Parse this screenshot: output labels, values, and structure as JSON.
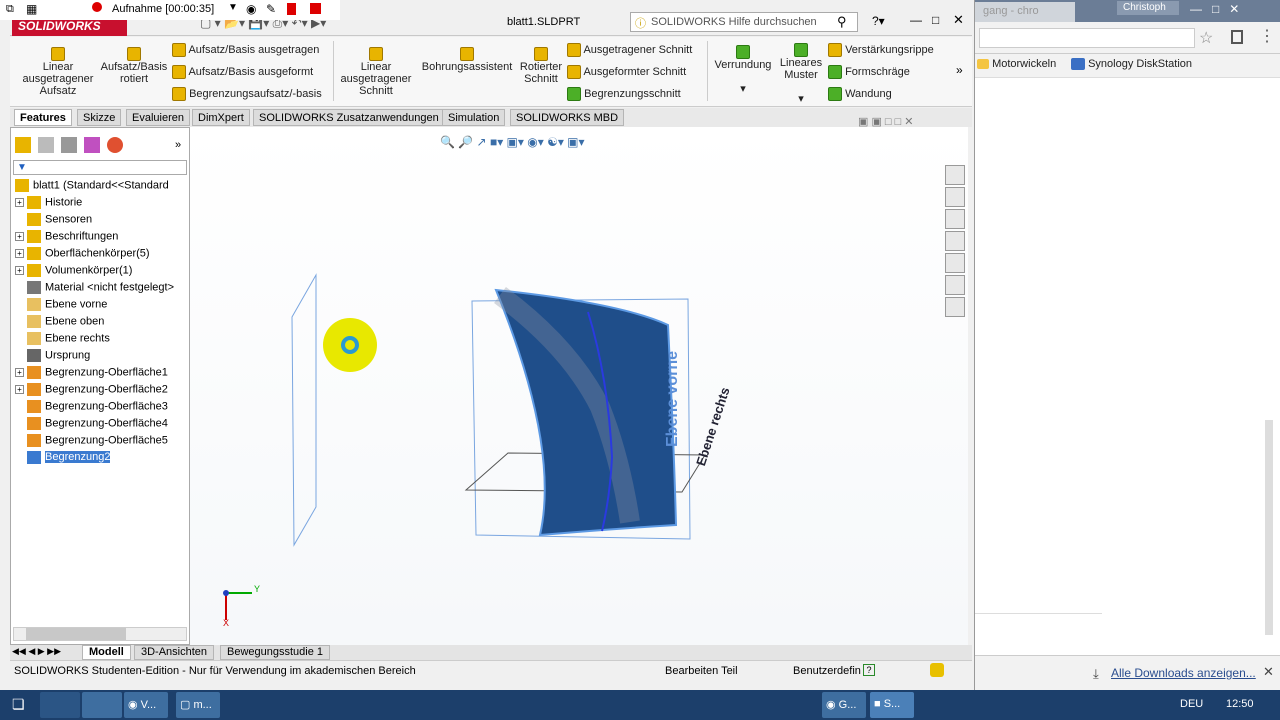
{
  "browser": {
    "tab_title": "gang - chro",
    "user_badge": "Christoph",
    "bookmarks": [
      "Motorwickeln",
      "Synology DiskStation"
    ],
    "downloads_link": "Alle Downloads anzeigen..."
  },
  "recording": {
    "label": "Aufnahme [00:00:35]"
  },
  "app": {
    "logo": "SOLIDWORKS",
    "doc_title": "blatt1.SLDPRT",
    "search_placeholder": "SOLIDWORKS Hilfe durchsuchen"
  },
  "ribbon": {
    "big": [
      {
        "label": "Linear ausgetragener Aufsatz"
      },
      {
        "label": "Aufsatz/Basis rotiert"
      },
      {
        "label": "Linear ausgetragener Schnitt"
      },
      {
        "label": "Bohrungsassistent"
      },
      {
        "label": "Rotierter Schnitt"
      },
      {
        "label": "Verrundung"
      },
      {
        "label": "Lineares Muster"
      }
    ],
    "small_col1": [
      "Aufsatz/Basis ausgetragen",
      "Aufsatz/Basis ausgeformt",
      "Begrenzungsaufsatz/-basis"
    ],
    "small_col2": [
      "Ausgetragener Schnitt",
      "Ausgeformter Schnitt",
      "Begrenzungsschnitt"
    ],
    "small_col3": [
      "Verstärkungsrippe",
      "Formschräge",
      "Wandung"
    ]
  },
  "tabs": [
    "Features",
    "Skizze",
    "Evaluieren",
    "DimXpert",
    "SOLIDWORKS Zusatzanwendungen",
    "Simulation",
    "SOLIDWORKS MBD"
  ],
  "tree": {
    "root": "blatt1  (Standard<<Standard",
    "items": [
      {
        "label": "Historie",
        "expand": "+"
      },
      {
        "label": "Sensoren",
        "expand": ""
      },
      {
        "label": "Beschriftungen",
        "expand": "+"
      },
      {
        "label": "Oberflächenkörper(5)",
        "expand": "+"
      },
      {
        "label": "Volumenkörper(1)",
        "expand": "+"
      },
      {
        "label": "Material <nicht festgelegt>",
        "expand": ""
      },
      {
        "label": "Ebene vorne",
        "expand": ""
      },
      {
        "label": "Ebene oben",
        "expand": ""
      },
      {
        "label": "Ebene rechts",
        "expand": ""
      },
      {
        "label": "Ursprung",
        "expand": ""
      },
      {
        "label": "Begrenzung-Oberfläche1",
        "expand": "+"
      },
      {
        "label": "Begrenzung-Oberfläche2",
        "expand": "+"
      },
      {
        "label": "Begrenzung-Oberfläche3",
        "expand": ""
      },
      {
        "label": "Begrenzung-Oberfläche4",
        "expand": ""
      },
      {
        "label": "Begrenzung-Oberfläche5",
        "expand": ""
      },
      {
        "label": "Begrenzung2",
        "expand": ""
      }
    ]
  },
  "viewport": {
    "plane_front": "Ebene vorne",
    "plane_right": "Ebene rechts",
    "axis_y": "Y",
    "axis_x": "X"
  },
  "bottom_tabs": [
    "Modell",
    "3D-Ansichten",
    "Bewegungsstudie 1"
  ],
  "status": {
    "left": "SOLIDWORKS Studenten-Edition - Nur für Verwendung im akademischen Bereich",
    "mid": "Bearbeiten Teil",
    "right": "Benutzerdefin"
  },
  "taskbar": {
    "items": [
      "V...",
      "m...",
      "G...",
      "S..."
    ],
    "lang": "DEU",
    "time": "12:50"
  }
}
